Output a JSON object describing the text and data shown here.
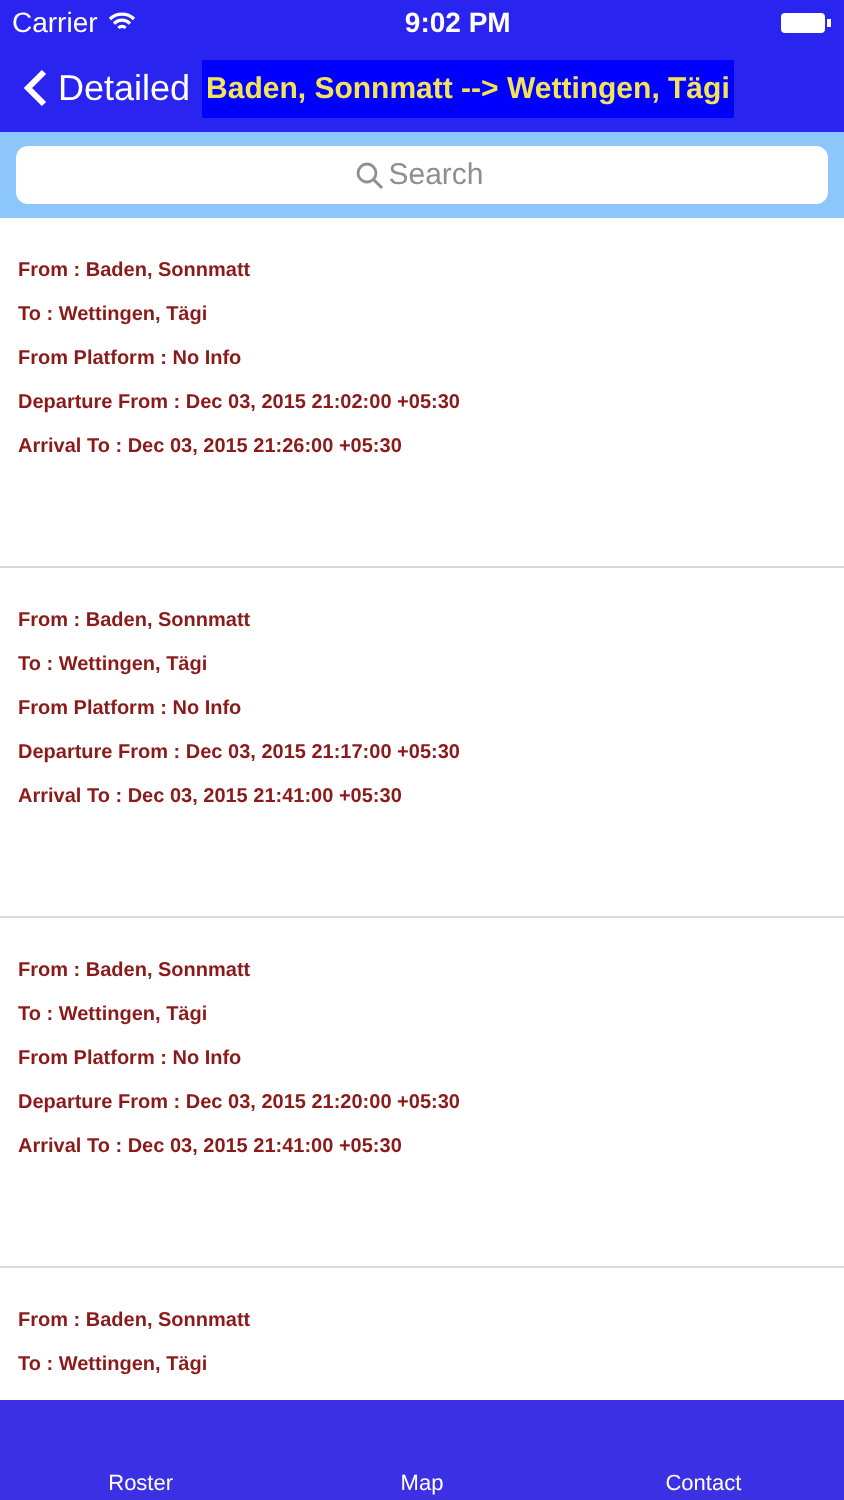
{
  "status_bar": {
    "carrier": "Carrier",
    "time": "9:02 PM"
  },
  "nav": {
    "back": "Detailed",
    "title": "Baden, Sonnmatt --> Wettingen, Tägi"
  },
  "search": {
    "placeholder": "Search"
  },
  "trips": [
    {
      "lines": [
        "From : Baden, Sonnmatt",
        "To : Wettingen, Tägi",
        "From Platform :  No Info",
        "Departure From :  Dec 03, 2015 21:02:00 +05:30",
        "Arrival To :  Dec 03, 2015 21:26:00 +05:30"
      ]
    },
    {
      "lines": [
        "From : Baden, Sonnmatt",
        "To : Wettingen, Tägi",
        "From Platform :  No Info",
        "Departure From :  Dec 03, 2015 21:17:00 +05:30",
        "Arrival To :  Dec 03, 2015 21:41:00 +05:30"
      ]
    },
    {
      "lines": [
        "From : Baden, Sonnmatt",
        "To : Wettingen, Tägi",
        "From Platform :  No Info",
        "Departure From :  Dec 03, 2015 21:20:00 +05:30",
        "Arrival To :  Dec 03, 2015 21:41:00 +05:30"
      ]
    },
    {
      "lines": [
        "From : Baden, Sonnmatt",
        "To : Wettingen, Tägi"
      ]
    }
  ],
  "tabs": [
    "Roster",
    "Map",
    "Contact"
  ]
}
